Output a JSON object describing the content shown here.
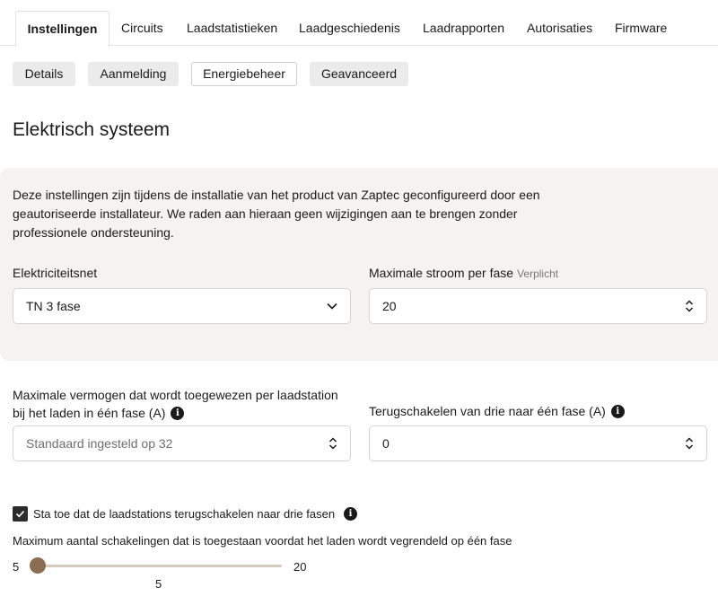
{
  "tabs": [
    "Instellingen",
    "Circuits",
    "Laadstatistieken",
    "Laadgeschiedenis",
    "Laadrapporten",
    "Autorisaties",
    "Firmware"
  ],
  "subtabs": [
    "Details",
    "Aanmelding",
    "Energiebeheer",
    "Geavanceerd"
  ],
  "section_title": "Elektrisch systeem",
  "panel": {
    "description": "Deze instellingen zijn tijdens de installatie van het product van Zaptec geconfigureerd door een geautoriseerde installateur. We raden aan hieraan geen wijzigingen aan te brengen zonder professionele ondersteuning.",
    "grid_label": "Elektriciteitsnet",
    "grid_value": "TN 3 fase",
    "max_current_label": "Maximale stroom per fase",
    "max_current_required": "Verplicht",
    "max_current_value": "20"
  },
  "single_phase": {
    "label_line1": "Maximale vermogen dat wordt toegewezen per laadstation",
    "label_line2": "bij het laden in één fase (A)",
    "placeholder": "Standaard ingesteld op 32"
  },
  "fallback": {
    "label": "Terugschakelen van drie naar één fase (A)",
    "value": "0"
  },
  "allow_switch": {
    "label": "Sta toe dat de laadstations terugschakelen naar drie fasen",
    "checked": true
  },
  "switch_limit": {
    "label": "Maximum aantal schakelingen dat is toegestaan voordat het laden wordt vegrendeld op één fase",
    "min": "5",
    "max": "20",
    "value": "5"
  },
  "colors": {
    "panel_bg": "#f5f3f1",
    "slider_thumb": "#8a6d52",
    "slider_track": "#d6cbbf"
  }
}
